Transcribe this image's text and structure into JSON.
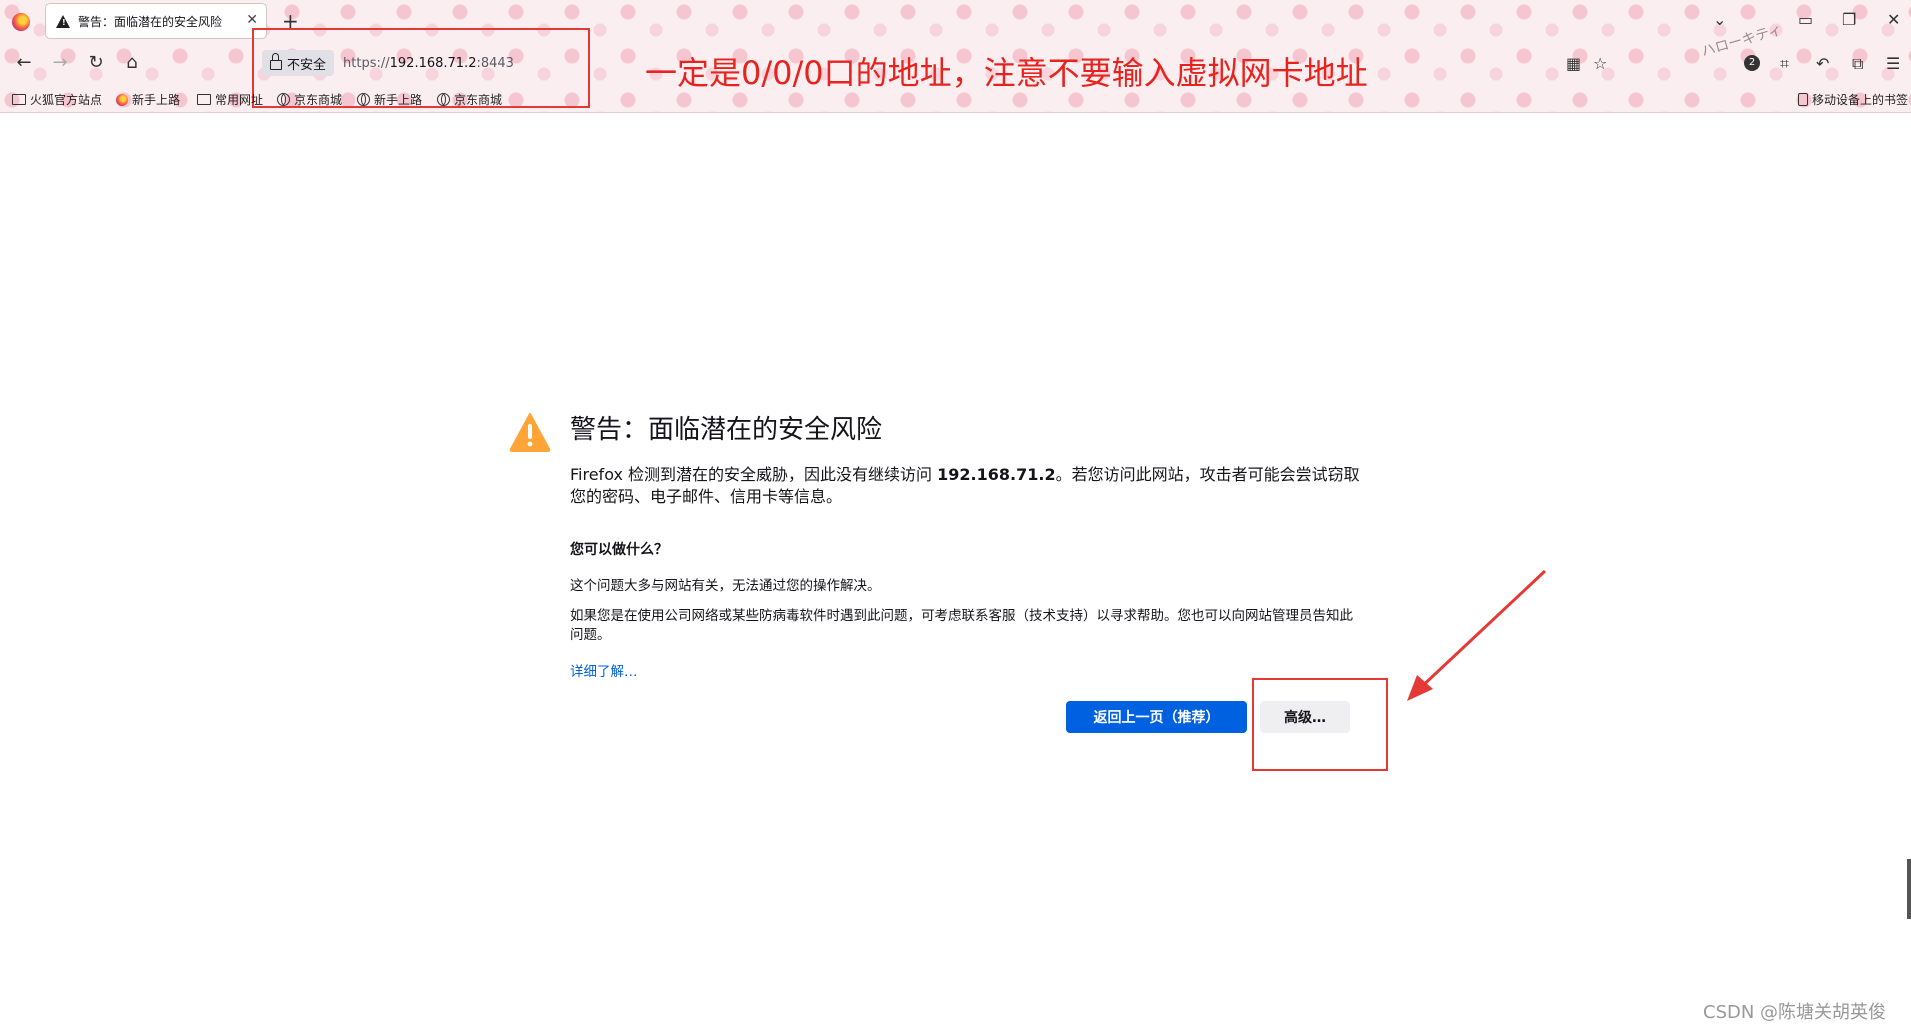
{
  "tab": {
    "title": "警告：面临潜在的安全风险"
  },
  "urlbar": {
    "security_label": "不安全",
    "url_prefix": "https://",
    "url_host": "192.168.71.2",
    "url_port": ":8443"
  },
  "annotation": {
    "text": "一定是0/0/0口的地址，注意不要输入虚拟网卡地址"
  },
  "extensions": {
    "badge_count": "2",
    "kitty_text": "ハローキティ"
  },
  "bookmarks": {
    "items": [
      "火狐官方站点",
      "新手上路",
      "常用网址",
      "京东商城",
      "新手上路",
      "京东商城"
    ],
    "mobile": "移动设备上的书签"
  },
  "error_page": {
    "title": "警告：面临潜在的安全风险",
    "desc_before": "Firefox 检测到潜在的安全威胁，因此没有继续访问 ",
    "desc_host": "192.168.71.2",
    "desc_after": "。若您访问此网站，攻击者可能会尝试窃取您的密码、电子邮件、信用卡等信息。",
    "what_heading": "您可以做什么？",
    "para1": "这个问题大多与网站有关，无法通过您的操作解决。",
    "para2": "如果您是在使用公司网络或某些防病毒软件时遇到此问题，可考虑联系客服（技术支持）以寻求帮助。您也可以向网站管理员告知此问题。",
    "learn_more": "详细了解…",
    "back_button": "返回上一页（推荐）",
    "advanced_button": "高级…"
  },
  "watermark": "CSDN @陈塘关胡英俊",
  "colors": {
    "accent_blue": "#0061e0",
    "annotation_red": "#e53935"
  }
}
